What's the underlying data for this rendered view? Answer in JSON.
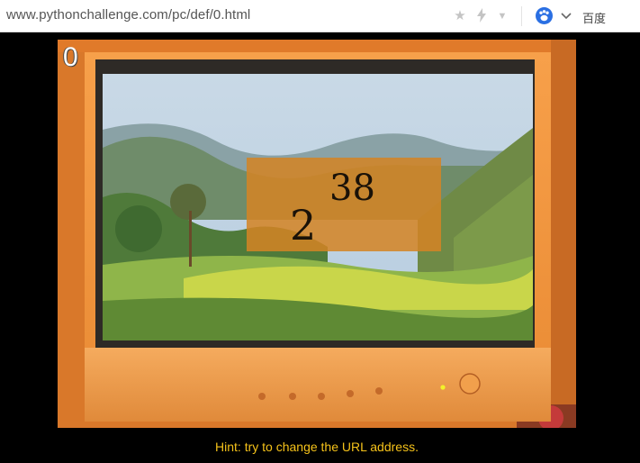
{
  "browser": {
    "url": "www.pythonchallenge.com/pc/def/0.html",
    "search_engine": "百度",
    "icons": [
      "star-icon",
      "lightning-icon",
      "dropdown-caret-icon",
      "paw-icon",
      "chevron-down-icon"
    ],
    "accent_color": "#2a6fe3"
  },
  "page": {
    "level_number": "0",
    "puzzle": {
      "base": "2",
      "exponent": "38"
    },
    "hint": "Hint: try to change the URL address.",
    "hint_color": "#f5c21a",
    "background_color": "#000000"
  }
}
